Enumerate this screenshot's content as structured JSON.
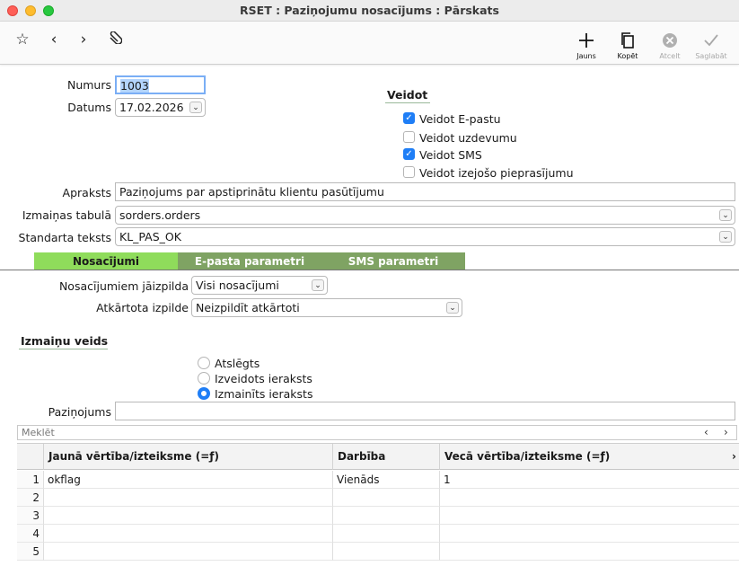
{
  "window": {
    "title": "RSET : Paziņojumu nosacījums : Pārskats"
  },
  "toolbar": {
    "star_icon": "star-icon",
    "back_icon": "chevron-left-icon",
    "forward_icon": "chevron-right-icon",
    "attach_icon": "paperclip-icon",
    "new_label": "Jauns",
    "copy_label": "Kopēt",
    "cancel_label": "Atcelt",
    "save_label": "Saglabāt"
  },
  "form": {
    "number_label": "Numurs",
    "number_value": "1003",
    "date_label": "Datums",
    "date_value": "17.02.2026",
    "create_title": "Veidot",
    "create_options": [
      {
        "label": "Veidot E-pastu",
        "checked": true
      },
      {
        "label": "Veidot uzdevumu",
        "checked": false
      },
      {
        "label": "Veidot SMS",
        "checked": true
      },
      {
        "label": "Veidot izejošo pieprasījumu",
        "checked": false
      }
    ],
    "description_label": "Apraksts",
    "description_value": "Paziņojums par apstiprinātu klientu pasūtījumu",
    "table_label": "Izmaiņas tabulā",
    "table_value": "sorders.orders",
    "standard_text_label": "Standarta teksts",
    "standard_text_value": "KL_PAS_OK"
  },
  "tabs": [
    {
      "label": "Nosacījumi",
      "active": true
    },
    {
      "label": "E-pasta parametri",
      "active": false
    },
    {
      "label": "SMS parametri",
      "active": false
    }
  ],
  "conditions": {
    "fulfill_label": "Nosacījumiem jāizpilda",
    "fulfill_value": "Visi nosacījumi",
    "repeat_label": "Atkārtota izpilde",
    "repeat_value": "Neizpildīt atkārtoti",
    "change_type_title": "Izmaiņu veids",
    "change_types": [
      {
        "label": "Atslēgts",
        "selected": false
      },
      {
        "label": "Izveidots ieraksts",
        "selected": false
      },
      {
        "label": "Izmainīts ieraksts",
        "selected": true
      }
    ],
    "notification_label": "Paziņojums",
    "notification_value": "",
    "search_placeholder": "Meklēt"
  },
  "grid": {
    "columns": [
      "Jaunā vērtība/izteiksme (=ƒ)",
      "Darbība",
      "Vecā vērtība/izteiksme (=ƒ)"
    ],
    "rows": [
      {
        "n": "1",
        "new": "okflag",
        "op": "Vienāds",
        "old": "1"
      },
      {
        "n": "2",
        "new": "",
        "op": "",
        "old": ""
      },
      {
        "n": "3",
        "new": "",
        "op": "",
        "old": ""
      },
      {
        "n": "4",
        "new": "",
        "op": "",
        "old": ""
      },
      {
        "n": "5",
        "new": "",
        "op": "",
        "old": ""
      }
    ]
  },
  "colors": {
    "accent": "#1f7ef6",
    "tab_active": "#8fdc5b",
    "tab_inactive": "#7fa363"
  }
}
